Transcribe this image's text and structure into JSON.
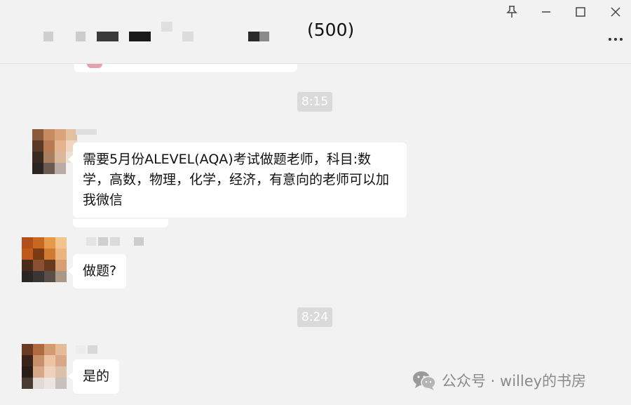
{
  "header": {
    "member_count": "(500)",
    "pin_label": "Pin",
    "minimize_label": "Minimize",
    "maximize_label": "Maximize",
    "close_label": "Close",
    "more_label": "More"
  },
  "messages": [
    {
      "time": "8:15",
      "text": "需要5月份ALEVEL(AQA)考试做题老师，科目:数学，高数，物理，化学，经济，有意向的老师可以加我微信"
    },
    {
      "text": "做题?"
    },
    {
      "time": "8:24",
      "text": "是的"
    }
  ],
  "watermark": {
    "text": "公众号 · willey的书房"
  },
  "colors": {
    "background": "#f2f2f2",
    "bubble": "#ffffff",
    "timestamp_bg": "#dadada",
    "watermark": "#8a8a8a"
  }
}
